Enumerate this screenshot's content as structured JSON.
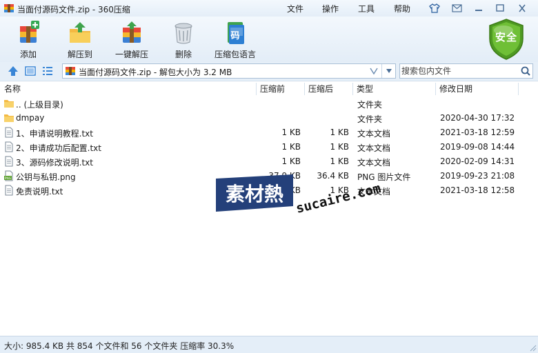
{
  "window": {
    "title": "当面付源码文件.zip - 360压缩"
  },
  "menu": [
    "文件",
    "操作",
    "工具",
    "帮助"
  ],
  "toolbar": [
    {
      "label": "添加",
      "icon": "add-archive-icon"
    },
    {
      "label": "解压到",
      "icon": "extract-to-icon"
    },
    {
      "label": "一键解压",
      "icon": "one-click-extract-icon"
    },
    {
      "label": "删除",
      "icon": "trash-icon"
    },
    {
      "label": "压缩包语言",
      "icon": "archive-language-icon",
      "badge": "码"
    }
  ],
  "security": {
    "label": "安全",
    "icon": "shield-icon"
  },
  "addressbar": {
    "path": "当面付源码文件.zip - 解包大小为 3.2 MB",
    "search_placeholder": "搜索包内文件"
  },
  "columns": [
    "名称",
    "压缩前",
    "压缩后",
    "类型",
    "修改日期"
  ],
  "files": [
    {
      "name": ".. (上级目录)",
      "packed": "",
      "unpacked": "",
      "type": "文件夹",
      "modified": "",
      "icon": "folder-icon"
    },
    {
      "name": "dmpay",
      "packed": "",
      "unpacked": "",
      "type": "文件夹",
      "modified": "2020-04-30 17:32",
      "icon": "folder-icon"
    },
    {
      "name": "1、申请说明教程.txt",
      "packed": "1 KB",
      "unpacked": "1 KB",
      "type": "文本文档",
      "modified": "2021-03-18 12:59",
      "icon": "text-file-icon"
    },
    {
      "name": "2、申请成功后配置.txt",
      "packed": "1 KB",
      "unpacked": "1 KB",
      "type": "文本文档",
      "modified": "2019-09-08 14:44",
      "icon": "text-file-icon"
    },
    {
      "name": "3、源码修改说明.txt",
      "packed": "1 KB",
      "unpacked": "1 KB",
      "type": "文本文档",
      "modified": "2020-02-09 14:31",
      "icon": "text-file-icon"
    },
    {
      "name": "公钥与私钥.png",
      "packed": "37.9 KB",
      "unpacked": "36.4 KB",
      "type": "PNG 图片文件",
      "modified": "2019-09-23 21:08",
      "icon": "png-file-icon"
    },
    {
      "name": "免责说明.txt",
      "packed": "1 KB",
      "unpacked": "1 KB",
      "type": "文本文档",
      "modified": "2021-03-18 12:58",
      "icon": "text-file-icon"
    }
  ],
  "watermark": {
    "logo": "素材熱",
    "domain": "sucaire.com"
  },
  "status": "大小: 985.4 KB 共 854 个文件和 56 个文件夹 压缩率 30.3%",
  "colors": {
    "chrome": "#e6eff8",
    "border": "#a9bfd6",
    "shield": "#5fa82a",
    "folder": "#f7c948",
    "watermark": "#24407a"
  }
}
